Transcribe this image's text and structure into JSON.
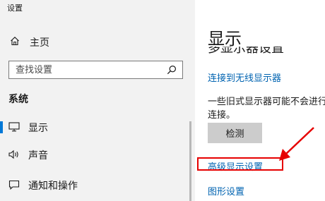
{
  "window": {
    "title": "设置"
  },
  "sidebar": {
    "home": {
      "label": "主页",
      "icon": "home-icon"
    },
    "search": {
      "placeholder": "查找设置",
      "icon": "search-icon"
    },
    "section_title": "系统",
    "items": [
      {
        "label": "显示",
        "icon": "monitor-icon",
        "active": true
      },
      {
        "label": "声音",
        "icon": "speaker-icon",
        "active": false
      },
      {
        "label": "通知和操作",
        "icon": "notification-icon",
        "active": false
      }
    ]
  },
  "main": {
    "title": "显示",
    "partial_heading": "多显示器设置",
    "wireless_link": "连接到无线显示器",
    "note": "一些旧式显示器可能不会进行连接。",
    "detect_button": "检测",
    "advanced_link": "高级显示设置",
    "graphics_link": "图形设置"
  },
  "annotation": {
    "color": "#e60000",
    "target": "advanced_link"
  },
  "colors": {
    "accent": "#0078d7",
    "link": "#0063b1",
    "sidebar_bg": "#f2f2f2"
  }
}
